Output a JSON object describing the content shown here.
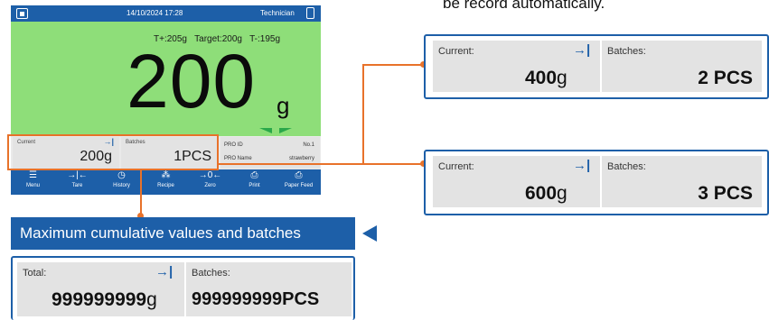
{
  "caption": "be record automatically.",
  "device": {
    "datetime": "14/10/2024 17:28",
    "role": "Technician",
    "target_line": "T+:205g   Target:200g   T-:195g",
    "weight": "200",
    "unit": "g",
    "current_label": "Current",
    "current_value": "200g",
    "batches_label": "Batches",
    "batches_value": "1PCS",
    "pro_id_label": "PRO ID",
    "pro_id_value": "No.1",
    "pro_name_label": "PRO Name",
    "pro_name_value": "strawberry",
    "nav": [
      {
        "label": "Menu",
        "icon": "menu-icon",
        "glyph": "☰"
      },
      {
        "label": "Tare",
        "icon": "tare-icon",
        "glyph": "→|←"
      },
      {
        "label": "History",
        "icon": "history-icon",
        "glyph": "◷"
      },
      {
        "label": "Recipe",
        "icon": "recipe-icon",
        "glyph": "⁂"
      },
      {
        "label": "Zero",
        "icon": "zero-icon",
        "glyph": "→0←"
      },
      {
        "label": "Print",
        "icon": "print-icon",
        "glyph": "⎙"
      },
      {
        "label": "Paper Feed",
        "icon": "paper-feed-icon",
        "glyph": "⎙"
      }
    ]
  },
  "panel1": {
    "current_label": "Current:",
    "value": "400",
    "unit": "g",
    "batches_label": "Batches:",
    "batches": "2 PCS"
  },
  "panel2": {
    "current_label": "Current:",
    "value": "600",
    "unit": "g",
    "batches_label": "Batches:",
    "batches": "3 PCS"
  },
  "banner": "Maximum cumulative values and batches",
  "panel3": {
    "total_label": "Total:",
    "value": "999999999",
    "unit": "g",
    "batches_label": "Batches:",
    "batches": "999999999PCS"
  },
  "colors": {
    "accent": "#1d5fa8",
    "display_bg": "#8ede79",
    "highlight": "#e8722a"
  }
}
